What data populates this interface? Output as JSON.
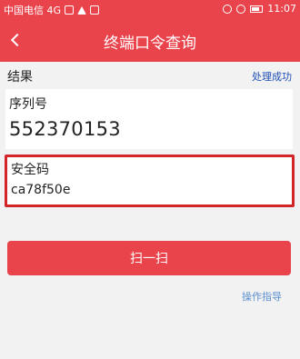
{
  "status_bar": {
    "carrier": "中国电信 4G",
    "time": "11:07"
  },
  "navbar": {
    "title": "终端口令查询"
  },
  "result": {
    "label": "结果",
    "status": "处理成功"
  },
  "serial": {
    "label": "序列号",
    "value": "552370153"
  },
  "security_code": {
    "label": "安全码",
    "value": "ca78f50e"
  },
  "actions": {
    "scan_label": "扫一扫",
    "guide_label": "操作指导"
  },
  "colors": {
    "brand_red": "#e9434c",
    "highlight_border": "#d2252a",
    "status_blue": "#1f4fb5",
    "link_blue": "#5a8fd0"
  },
  "icons": [
    "back-chevron-icon",
    "wifi-icon",
    "battery-icon",
    "alarm-icon",
    "warning-icon"
  ]
}
